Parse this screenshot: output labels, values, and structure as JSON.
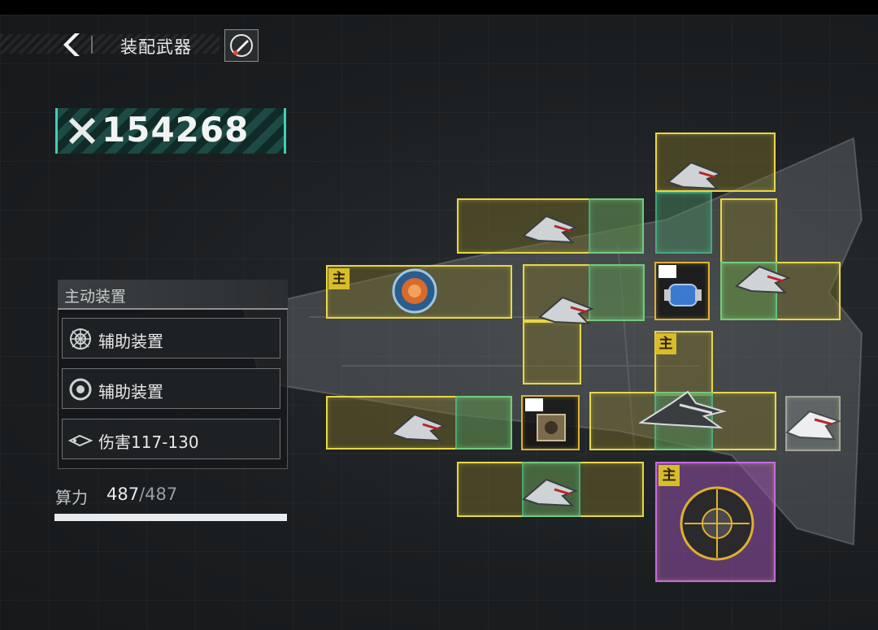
{
  "header": {
    "title": "装配武器",
    "back_icon": "chevron-left-icon",
    "ship_icon": "rocket-icon"
  },
  "power": {
    "value": "154268",
    "icon": "crossed-swords-icon"
  },
  "panel": {
    "title": "主动装置",
    "slots": [
      {
        "label": "辅助装置",
        "icon": "shield-web-icon"
      },
      {
        "label": "辅助装置",
        "icon": "target-ring-icon"
      },
      {
        "label": "伤害117-130",
        "icon": "damage-arrow-icon"
      }
    ]
  },
  "compute": {
    "label": "算力",
    "used": "487",
    "total": "/487",
    "fill": 1.0
  },
  "grid": {
    "main_tag": "主",
    "colors": {
      "yellow": "#e8d64a",
      "green": "#50dca0",
      "purple": "#c46be0",
      "gray": "#9fa4a8"
    },
    "modules": [
      {
        "id": "reactor-core",
        "icon": "reactor-core-icon",
        "main": true
      },
      {
        "id": "fighter-1",
        "icon": "fighter-ship-icon"
      },
      {
        "id": "fighter-2",
        "icon": "fighter-ship-icon"
      },
      {
        "id": "fighter-3",
        "icon": "fighter-ship-icon"
      },
      {
        "id": "fighter-4",
        "icon": "fighter-ship-icon"
      },
      {
        "id": "fighter-5",
        "icon": "fighter-ship-icon"
      },
      {
        "id": "fighter-6",
        "icon": "fighter-ship-icon"
      },
      {
        "id": "fighter-7",
        "icon": "fighter-ship-icon"
      },
      {
        "id": "bomber",
        "icon": "heavy-fighter-icon",
        "main": true
      },
      {
        "id": "capsule",
        "icon": "energy-capsule-icon"
      },
      {
        "id": "chip",
        "icon": "circuit-chip-icon"
      },
      {
        "id": "spherical-drone",
        "icon": "sphere-drone-icon",
        "main": true
      },
      {
        "id": "external-fighter",
        "icon": "white-fighter-icon"
      }
    ]
  }
}
